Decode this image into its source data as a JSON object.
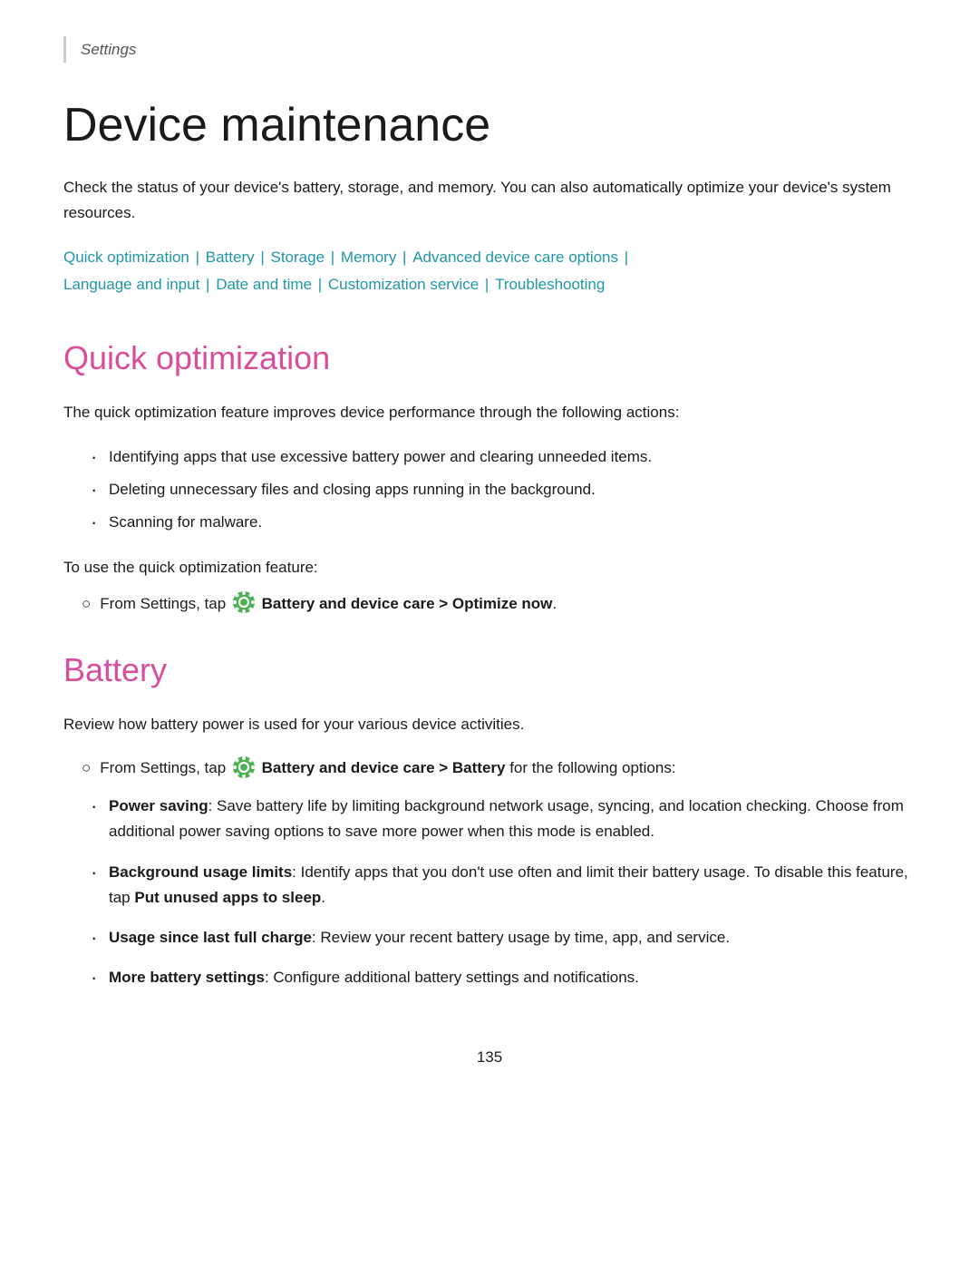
{
  "breadcrumb": {
    "label": "Settings"
  },
  "page": {
    "title": "Device maintenance",
    "intro": "Check the status of your device's battery, storage, and memory. You can also automatically optimize your device's system resources."
  },
  "nav": {
    "links": [
      {
        "label": "Quick optimization",
        "id": "quick-opt"
      },
      {
        "label": "Battery",
        "id": "battery"
      },
      {
        "label": "Storage",
        "id": "storage"
      },
      {
        "label": "Memory",
        "id": "memory"
      },
      {
        "label": "Advanced device care options",
        "id": "advanced"
      },
      {
        "label": "Language and input",
        "id": "lang"
      },
      {
        "label": "Date and time",
        "id": "date"
      },
      {
        "label": "Customization service",
        "id": "custom"
      },
      {
        "label": "Troubleshooting",
        "id": "trouble"
      }
    ]
  },
  "quick_optimization": {
    "heading": "Quick optimization",
    "intro": "The quick optimization feature improves device performance through the following actions:",
    "bullets": [
      "Identifying apps that use excessive battery power and clearing unneeded items.",
      "Deleting unnecessary files and closing apps running in the background.",
      "Scanning for malware."
    ],
    "use_text": "To use the quick optimization feature:",
    "step": {
      "prefix": "From Settings, tap",
      "bold_part": "Battery and device care > Optimize now",
      "suffix": "."
    }
  },
  "battery": {
    "heading": "Battery",
    "intro": "Review how battery power is used for your various device activities.",
    "step": {
      "prefix": "From Settings, tap",
      "bold_part": "Battery and device care > Battery",
      "suffix": "for the following options:"
    },
    "options": [
      {
        "bold": "Power saving",
        "text": ": Save battery life by limiting background network usage, syncing, and location checking. Choose from additional power saving options to save more power when this mode is enabled."
      },
      {
        "bold": "Background usage limits",
        "text": ": Identify apps that you don’t use often and limit their battery usage. To disable this feature, tap",
        "bold2": "Put unused apps to sleep",
        "text2": "."
      },
      {
        "bold": "Usage since last full charge",
        "text": ": Review your recent battery usage by time, app, and service."
      },
      {
        "bold": "More battery settings",
        "text": ": Configure additional battery settings and notifications."
      }
    ]
  },
  "page_number": "135"
}
